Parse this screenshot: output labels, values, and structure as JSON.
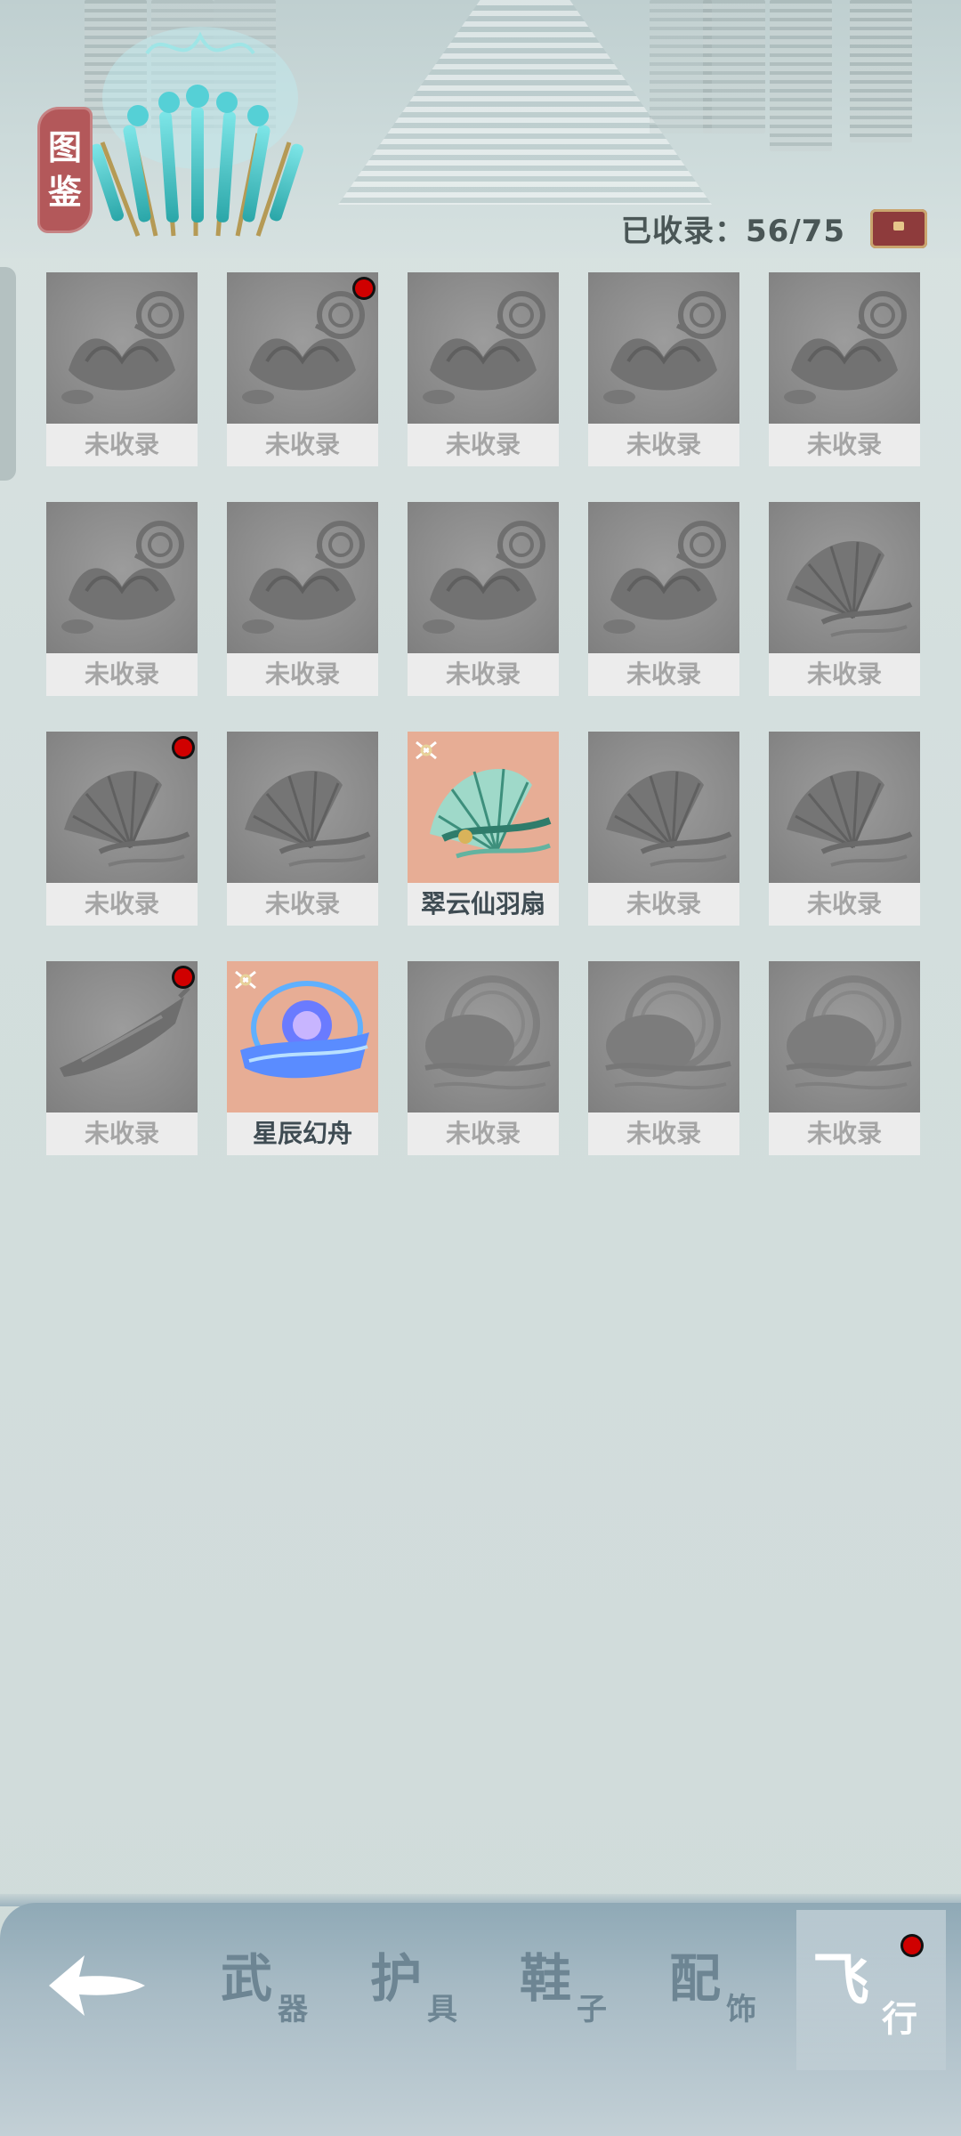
{
  "header": {
    "title_chars": [
      "图",
      "鉴"
    ],
    "collected_label": "已收录：56/75"
  },
  "grid": {
    "items": [
      {
        "label": "未收录",
        "collected": false,
        "shape": "lotus",
        "dot": false
      },
      {
        "label": "未收录",
        "collected": false,
        "shape": "lotus",
        "dot": true
      },
      {
        "label": "未收录",
        "collected": false,
        "shape": "lotus",
        "dot": false
      },
      {
        "label": "未收录",
        "collected": false,
        "shape": "lotus",
        "dot": false
      },
      {
        "label": "未收录",
        "collected": false,
        "shape": "lotus",
        "dot": false
      },
      {
        "label": "未收录",
        "collected": false,
        "shape": "lotus",
        "dot": false
      },
      {
        "label": "未收录",
        "collected": false,
        "shape": "lotus",
        "dot": false
      },
      {
        "label": "未收录",
        "collected": false,
        "shape": "lotus",
        "dot": false
      },
      {
        "label": "未收录",
        "collected": false,
        "shape": "lotus",
        "dot": false
      },
      {
        "label": "未收录",
        "collected": false,
        "shape": "fan",
        "dot": false
      },
      {
        "label": "未收录",
        "collected": false,
        "shape": "fan",
        "dot": true
      },
      {
        "label": "未收录",
        "collected": false,
        "shape": "fan",
        "dot": false
      },
      {
        "label": "翠云仙羽扇",
        "collected": true,
        "shape": "fan",
        "dot": false
      },
      {
        "label": "未收录",
        "collected": false,
        "shape": "fan",
        "dot": false
      },
      {
        "label": "未收录",
        "collected": false,
        "shape": "fan",
        "dot": false
      },
      {
        "label": "未收录",
        "collected": false,
        "shape": "boat",
        "dot": true
      },
      {
        "label": "星辰幻舟",
        "collected": true,
        "shape": "orb",
        "dot": false
      },
      {
        "label": "未收录",
        "collected": false,
        "shape": "ring",
        "dot": false
      },
      {
        "label": "未收录",
        "collected": false,
        "shape": "ring",
        "dot": false
      },
      {
        "label": "未收录",
        "collected": false,
        "shape": "ring",
        "dot": false
      }
    ]
  },
  "nav": {
    "back_icon": "back-arrow-icon",
    "tabs": [
      {
        "big": "武",
        "small": "器"
      },
      {
        "big": "护",
        "small": "具"
      },
      {
        "big": "鞋",
        "small": "子"
      },
      {
        "big": "配",
        "small": "饰"
      },
      {
        "big": "飞",
        "small": "行"
      }
    ]
  },
  "colors": {
    "accent_red": "#d00000",
    "badge": "#b3585a",
    "collected_bg": "#e7ad95"
  }
}
